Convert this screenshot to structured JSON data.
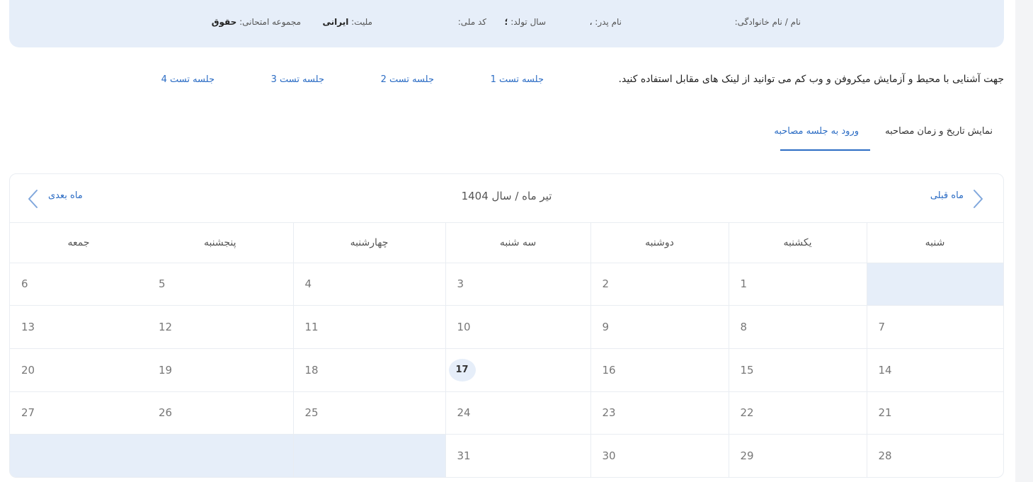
{
  "header_info": {
    "name_label": "نام / نام خانوادگی:",
    "father_label": "نام پدر:",
    "father_value": "،",
    "birth_label": "سال تولد:",
    "birth_value": "؛",
    "national_code_label": "کد ملی:",
    "nationality_label": "ملیت:",
    "nationality_value": "ایرانی",
    "exam_group_label": "مجموعه امتحانی:",
    "exam_group_value": "حقوق"
  },
  "intro": {
    "text": "جهت آشنایی با محیط و آزمایش میکروفن و وب کم می توانید از لینک های مقابل استفاده کنید.",
    "links": [
      "جلسه تست 1",
      "جلسه تست 2",
      "جلسه تست 3",
      "جلسه تست 4"
    ]
  },
  "tabs": {
    "show_dates": "نمایش تاریخ و زمان مصاحبه",
    "enter_session": "ورود به جلسه مصاحبه",
    "active": "enter_session"
  },
  "calendar": {
    "title": "تیر ماه / سال 1404",
    "prev_label": "ماه قبلی",
    "next_label": "ماه بعدی",
    "weekdays": [
      "جمعه",
      "پنجشنبه",
      "چهارشنبه",
      "سه شنبه",
      "دوشنبه",
      "یکشنبه",
      "شنبه"
    ],
    "weeks": [
      [
        "6",
        "5",
        "4",
        "3",
        "2",
        "1",
        ""
      ],
      [
        "13",
        "12",
        "11",
        "10",
        "9",
        "8",
        "7"
      ],
      [
        "20",
        "19",
        "18",
        "17",
        "16",
        "15",
        "14"
      ],
      [
        "27",
        "26",
        "25",
        "24",
        "23",
        "22",
        "21"
      ],
      [
        "",
        "",
        "",
        "31",
        "30",
        "29",
        "28"
      ]
    ],
    "today": "17"
  },
  "colors": {
    "accent": "#2b6cc4",
    "panel_bg": "#e6eef9"
  }
}
